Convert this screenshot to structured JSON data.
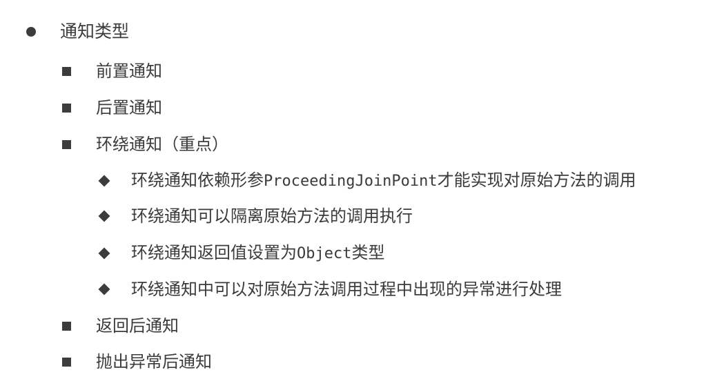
{
  "slide": {
    "title": "通知类型",
    "items": [
      {
        "label": "前置通知"
      },
      {
        "label": "后置通知"
      },
      {
        "label": "环绕通知（重点）",
        "subitems": [
          {
            "pre": "环绕通知依赖形参",
            "code": "ProceedingJoinPoint",
            "post": "才能实现对原始方法的调用"
          },
          {
            "pre": "环绕通知可以隔离原始方法的调用执行",
            "code": "",
            "post": ""
          },
          {
            "pre": "环绕通知返回值设置为",
            "code": "Object",
            "post": "类型"
          },
          {
            "pre": "环绕通知中可以对原始方法调用过程中出现的异常进行处理",
            "code": "",
            "post": ""
          }
        ]
      },
      {
        "label": "返回后通知"
      },
      {
        "label": "抛出异常后通知"
      }
    ]
  },
  "colors": {
    "text": "#3b3b3b",
    "bullet": "#3c3c3c",
    "background": "#ffffff"
  }
}
